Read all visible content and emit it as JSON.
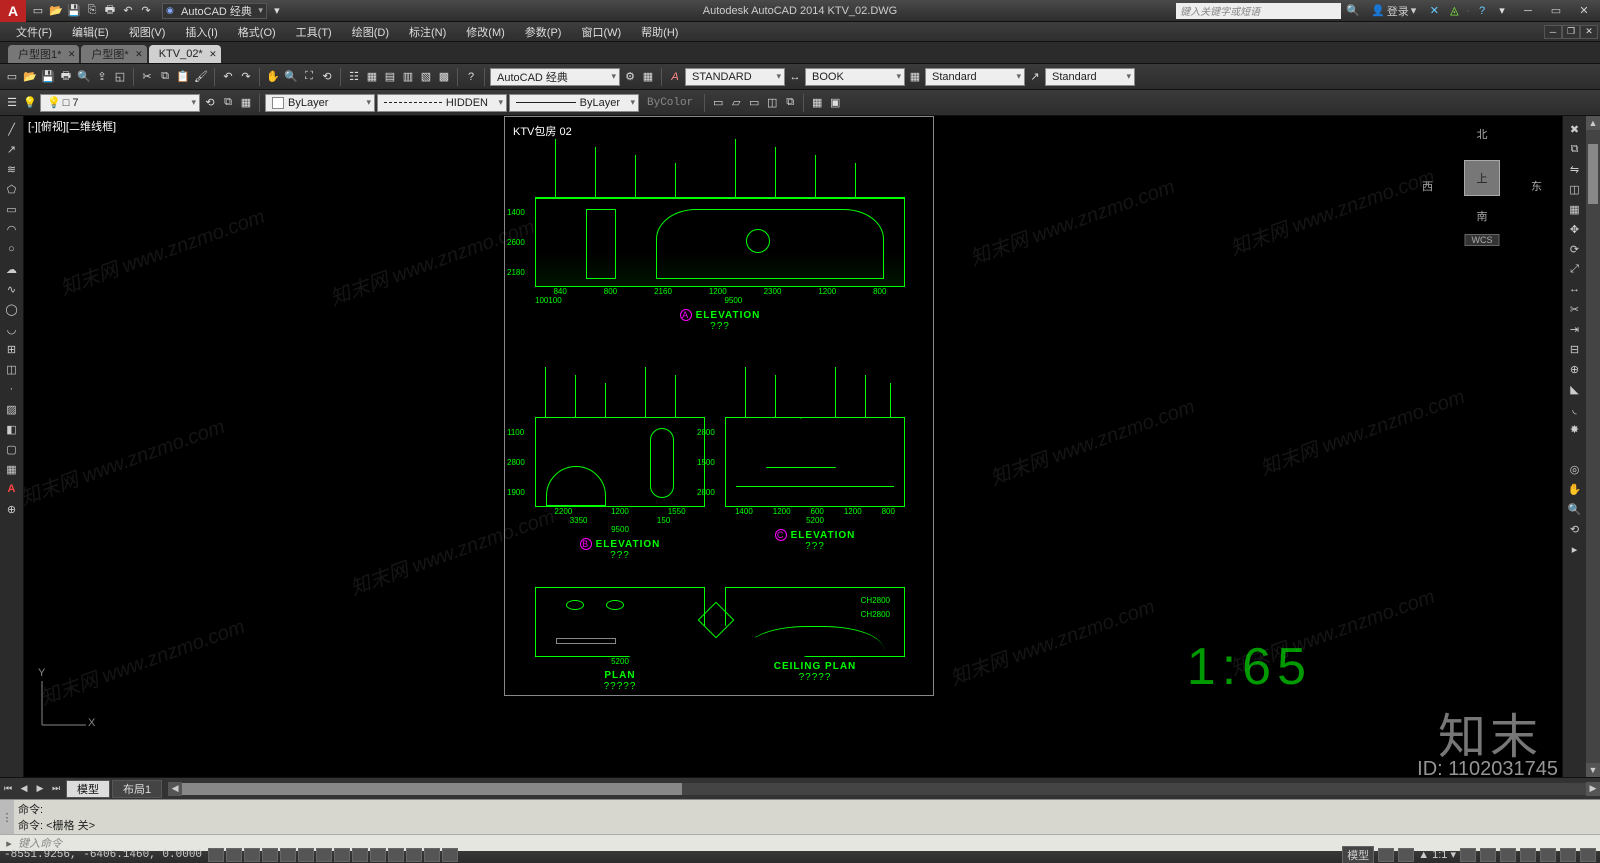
{
  "titlebar": {
    "app_initial": "A",
    "workspace": "AutoCAD 经典",
    "title": "Autodesk AutoCAD 2014    KTV_02.DWG",
    "search_placeholder": "键入关键字或短语",
    "login_label": "登录"
  },
  "menubar": {
    "items": [
      "文件(F)",
      "编辑(E)",
      "视图(V)",
      "插入(I)",
      "格式(O)",
      "工具(T)",
      "绘图(D)",
      "标注(N)",
      "修改(M)",
      "参数(P)",
      "窗口(W)",
      "帮助(H)"
    ]
  },
  "file_tabs": [
    {
      "label": "户型图1*",
      "active": false
    },
    {
      "label": "户型图*",
      "active": false
    },
    {
      "label": "KTV_02*",
      "active": true
    }
  ],
  "toolbar1": {
    "workspace": "AutoCAD 经典",
    "text_style": "STANDARD",
    "dim_style": "BOOK",
    "table_style": "Standard",
    "ml_style": "Standard"
  },
  "toolbar2": {
    "layer": "□ 7",
    "color_label": "ByLayer",
    "linetype": "HIDDEN",
    "lineweight": "ByLayer",
    "plot_style": "ByColor"
  },
  "viewport": {
    "label": "[-][俯视][二维线框]"
  },
  "viewcube": {
    "top": "北",
    "left": "西",
    "right": "东",
    "bottom": "南",
    "face": "上",
    "wcs": "WCS"
  },
  "drawing": {
    "sheet_title": "KTV包房   02",
    "elevA": {
      "tag": "A",
      "caption": "ELEVATION",
      "sub": "???",
      "dims_top": [
        "840",
        "800",
        "2160",
        "1200",
        "2300",
        "1200",
        "800"
      ],
      "dims_bot": [
        "100",
        "100",
        "9500"
      ],
      "dims_v": [
        "1400",
        "2600",
        "2180"
      ]
    },
    "elevB": {
      "tag": "B",
      "caption": "ELEVATION",
      "sub": "???",
      "dims_top": [
        "2200",
        "1200",
        "1550"
      ],
      "dims_bot": [
        "3350",
        "150",
        "9500"
      ],
      "dims_v": [
        "1100",
        "2800",
        "1900"
      ]
    },
    "elevC": {
      "tag": "C",
      "caption": "ELEVATION",
      "sub": "???",
      "dims_top": [
        "1400",
        "1200",
        "600",
        "1200",
        "800"
      ],
      "dims_bot": [
        "5200"
      ],
      "dims_v": [
        "2800",
        "1500",
        "2800"
      ]
    },
    "plan": {
      "caption": "PLAN",
      "sub": "?????",
      "dim": "5200"
    },
    "ceiling": {
      "caption": "CEILING PLAN",
      "sub": "?????",
      "note1": "CH2800",
      "note2": "CH2800"
    }
  },
  "big_ratio": "1:65",
  "brand": "知末",
  "brand_id": "ID: 1102031745",
  "watermark": "知末网 www.znzmo.com",
  "layout_tabs": {
    "model": "模型",
    "layout1": "布局1"
  },
  "command": {
    "line1": "命令:",
    "line2": "命令: <栅格 关>",
    "input_hint": "键入命令"
  },
  "statusbar": {
    "coords": "-8551.9256, -6406.1460, 0.0000",
    "model_btn": "模型",
    "scale": "▲ 1:1 ▾"
  }
}
